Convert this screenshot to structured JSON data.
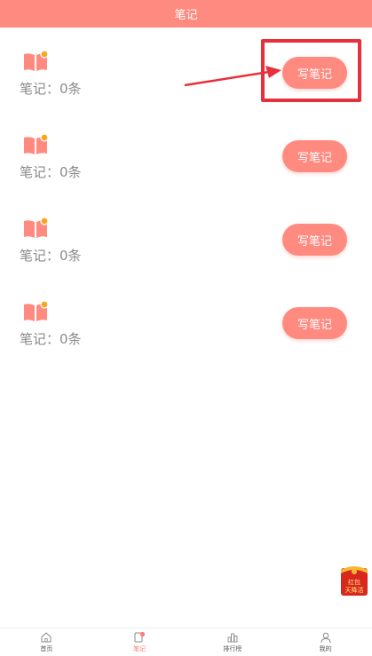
{
  "header": {
    "title": "笔记"
  },
  "notes": [
    {
      "count_text": "笔记：0条",
      "button_label": "写笔记"
    },
    {
      "count_text": "笔记：0条",
      "button_label": "写笔记"
    },
    {
      "count_text": "笔记：0条",
      "button_label": "写笔记"
    },
    {
      "count_text": "笔记：0条",
      "button_label": "写笔记"
    }
  ],
  "promo": {
    "line1": "红包",
    "line2": "天降活"
  },
  "tabbar": {
    "items": [
      {
        "label": "首页",
        "icon": "home-icon",
        "active": false
      },
      {
        "label": "笔记",
        "icon": "note-icon",
        "active": true
      },
      {
        "label": "排行榜",
        "icon": "ranking-icon",
        "active": false
      },
      {
        "label": "我的",
        "icon": "profile-icon",
        "active": false
      }
    ]
  },
  "colors": {
    "accent": "#ff8a80",
    "highlight": "#e8303c",
    "text_muted": "#8a8a8a",
    "book": "#ff8a80",
    "book_badge": "#f5a623"
  }
}
